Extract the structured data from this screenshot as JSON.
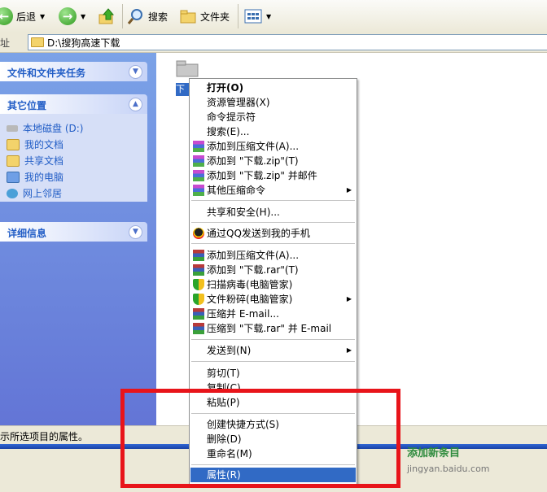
{
  "toolbar": {
    "back": "后退",
    "search": "搜索",
    "folders": "文件夹"
  },
  "address": {
    "label": "址",
    "path": "D:\\搜狗高速下载"
  },
  "left_pane": {
    "tasks_title": "文件和文件夹任务",
    "other_title": "其它位置",
    "other_items": [
      "本地磁盘 (D:)",
      "我的文档",
      "共享文档",
      "我的电脑",
      "网上邻居"
    ],
    "details_title": "详细信息"
  },
  "folder": {
    "label": "下"
  },
  "status_bar": {
    "text": "示所选项目的属性。"
  },
  "watermark": {
    "text": "添加新条目",
    "url": "jingyan.baidu.com"
  },
  "context_menu": {
    "open": "打开(O)",
    "explorer": "资源管理器(X)",
    "cmd": "命令提示符",
    "search": "搜索(E)...",
    "add_archive_zip": "添加到压缩文件(A)...",
    "add_zip": "添加到 \"下载.zip\"(T)",
    "add_zip_mail": "添加到 \"下载.zip\" 并邮件",
    "other_compress": "其他压缩命令",
    "share_security": "共享和安全(H)...",
    "qq_send": "通过QQ发送到我的手机",
    "add_archive_rar": "添加到压缩文件(A)...",
    "add_rar": "添加到 \"下载.rar\"(T)",
    "scan_virus": "扫描病毒(电脑管家)",
    "shred": "文件粉碎(电脑管家)",
    "compress_email": "压缩并 E-mail...",
    "compress_rar_email": "压缩到 \"下载.rar\" 并 E-mail",
    "send_to": "发送到(N)",
    "cut": "剪切(T)",
    "copy": "复制(C)",
    "paste": "粘贴(P)",
    "create_shortcut": "创建快捷方式(S)",
    "delete": "删除(D)",
    "rename": "重命名(M)",
    "properties": "属性(R)"
  },
  "colors": {
    "highlight": "#316ac5",
    "annotation_red": "#e8141a",
    "pane_blue": "#6375d6"
  }
}
